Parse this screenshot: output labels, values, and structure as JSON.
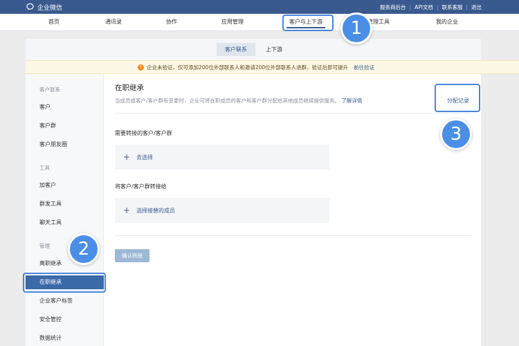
{
  "topbar": {
    "brand": "企业微信",
    "links": [
      "服务商后台",
      "API文档",
      "联系客服",
      "退出"
    ]
  },
  "nav": {
    "items": [
      "首页",
      "通讯录",
      "协作",
      "应用管理",
      "客户与上下游",
      "管理工具",
      "我的企业"
    ],
    "active_index": 4
  },
  "subtabs": {
    "items": [
      "客户联系",
      "上下游"
    ],
    "active_index": 0
  },
  "notice": {
    "icon": "warning-icon",
    "text": "企业未验证，仅可添加200位外部联系人和邀请200位外部联系人进群，验证后即可提升",
    "link": "前往验证"
  },
  "sidebar": {
    "groups": [
      {
        "label": "客户联系",
        "items": [
          "客户",
          "客户群",
          "客户朋友圈"
        ]
      },
      {
        "label": "工具",
        "items": [
          "加客户",
          "群发工具",
          "聊天工具"
        ]
      },
      {
        "label": "管理",
        "items": [
          "离职继承",
          "在职继承",
          "企业客户标签",
          "安全管控",
          "数据统计"
        ]
      }
    ],
    "active_item": "在职继承"
  },
  "main": {
    "title": "在职继承",
    "description": "当成员或客户/客户群有变更时，企业可将在职成员的客户和客户群分配给其他成员继续提供服务。",
    "more_link": "了解详情",
    "assign_log": "分配记录",
    "section1_label": "需要转接的客户/客户群",
    "section1_action": "去选择",
    "section2_label": "将客户/客户群转接给",
    "section2_action": "选择接替的成员",
    "confirm_button": "确认转接"
  },
  "callouts": [
    "1",
    "2",
    "3"
  ],
  "colors": {
    "topbar": "#3a5a8f",
    "accent": "#3a5a8f",
    "sidebar_active": "#3a6aa8",
    "callout": "#4a8ee6",
    "notice_bg": "#fdf8e6",
    "warning": "#f08a1a"
  }
}
